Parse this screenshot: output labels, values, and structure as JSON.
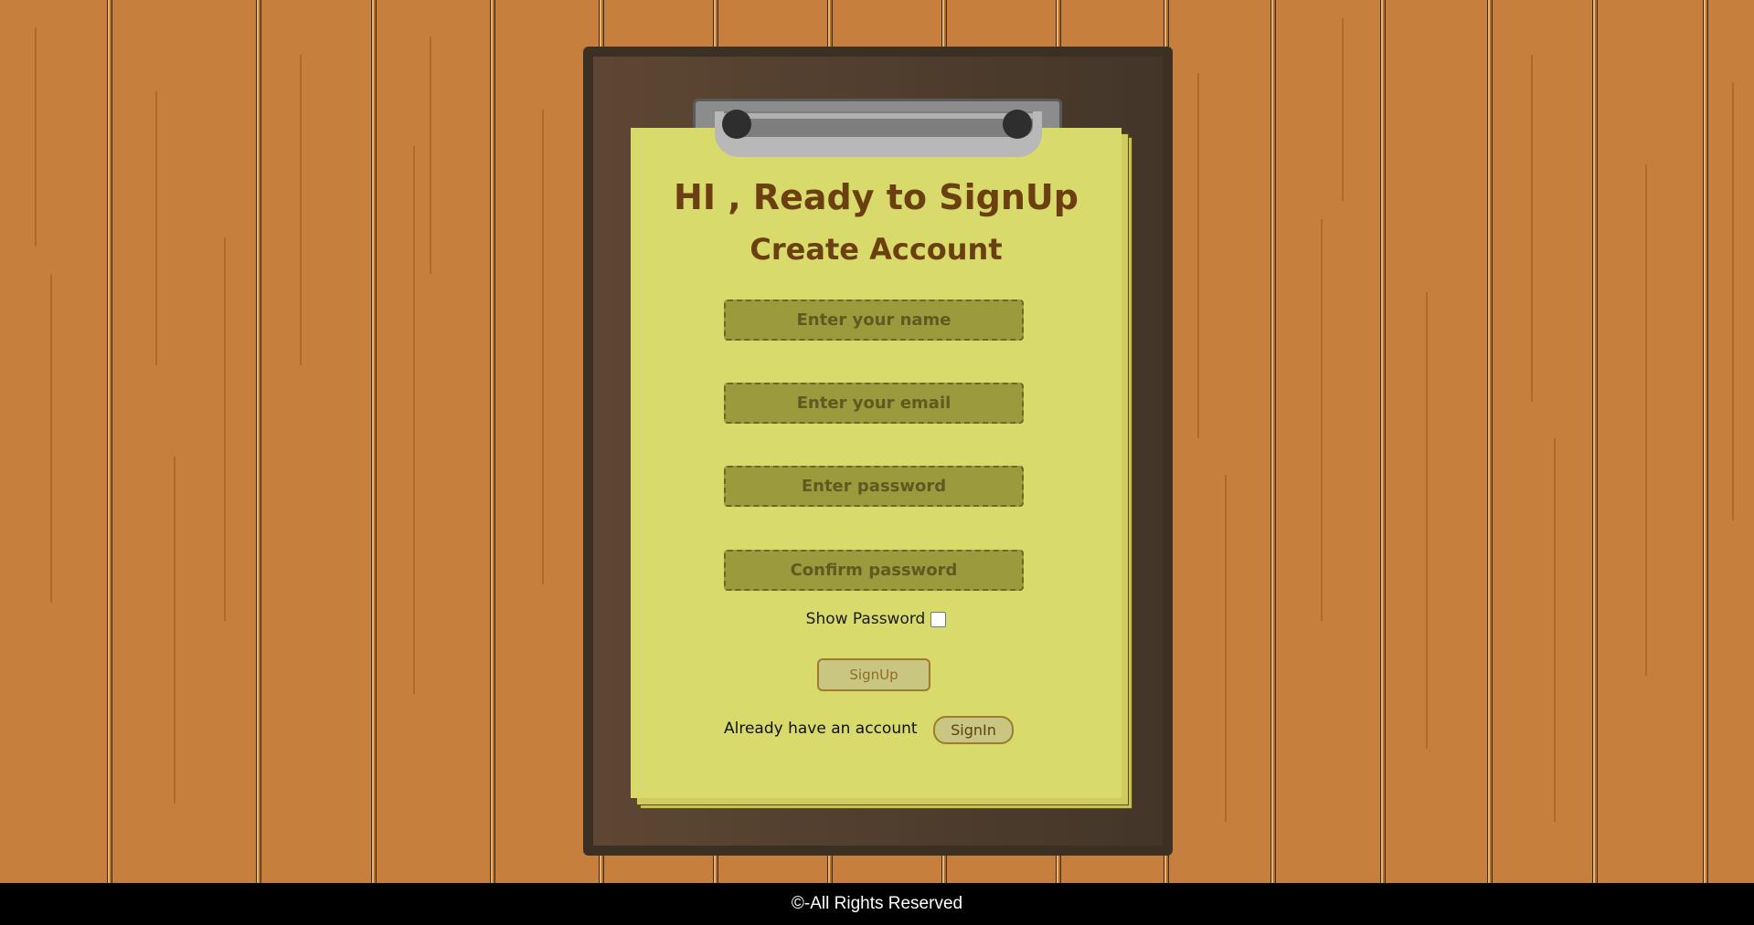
{
  "header": {
    "greeting": "HI , Ready to SignUp",
    "subtitle": "Create Account"
  },
  "form": {
    "name_placeholder": "Enter your name",
    "email_placeholder": "Enter your email",
    "password_placeholder": "Enter password",
    "confirm_placeholder": "Confirm password",
    "show_password_label": "Show Password",
    "show_password_checked": false,
    "signup_label": "SignUp"
  },
  "signin": {
    "prompt": "Already have an account",
    "button_label": "SignIn"
  },
  "footer": {
    "text": "©-All Rights Reserved"
  },
  "colors": {
    "wood": "#c67f3c",
    "paper": "#d9da6c",
    "heading": "#6b3f10",
    "field_bg": "#9b9a3c",
    "board": "#3b3023"
  }
}
